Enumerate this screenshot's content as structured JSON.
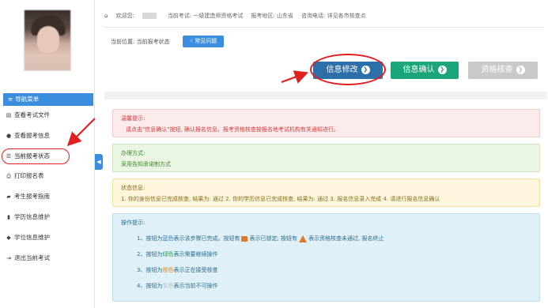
{
  "sidebar": {
    "nav_title": "导航菜单",
    "items": [
      {
        "label": "查看考试文件",
        "icon": "document-icon"
      },
      {
        "label": "查看报考信息",
        "icon": "info-icon"
      },
      {
        "label": "当前报考状态",
        "icon": "list-icon"
      },
      {
        "label": "打印报名表",
        "icon": "printer-icon"
      },
      {
        "label": "考生报考指南",
        "icon": "book-icon"
      },
      {
        "label": "学历信息维护",
        "icon": "file-icon"
      },
      {
        "label": "学位信息维护",
        "icon": "graduation-cap-icon"
      },
      {
        "label": "退出当前考试",
        "icon": "logout-icon"
      }
    ],
    "collapse_glyph": "◀"
  },
  "infobar": {
    "welcome": "欢迎您:",
    "exam": "当前考试: 一级建造师资格考试",
    "region": "报考地区: 山东省",
    "phone": "咨询电话: 详见各市核查点"
  },
  "breadcrumb": {
    "prefix": "当前位置:",
    "current": "当前报考状态",
    "faq_label": "常见问题"
  },
  "actions": {
    "modify": "信息修改",
    "confirm": "信息确认",
    "check": "资格核查"
  },
  "panels": {
    "warn": {
      "title": "温馨提示:",
      "body": "请点击\"信息确认\"按钮, 确认报名信息。报考资格核查按报名地考试机构有关通知进行。"
    },
    "method": {
      "title": "办理方式:",
      "body": "采用告知承诺制方式"
    },
    "status": {
      "title": "状态信息:",
      "body": "1. 你的身份信息已完成核查, 结果为: 通过 2. 你的学历信息已完成核查, 结果为: 通过 3. 报名信息录入完成 4. 请进行报名信息确认"
    },
    "ops": {
      "title": "操作提示:",
      "op1_a": "1、按钮为",
      "op1_blue": "蓝色",
      "op1_b": "表示该步骤已完成。按钮有",
      "op1_c": "表示已锁定; 按钮有",
      "op1_d": "表示资格核查未通过, 报名终止",
      "op2_a": "2、按钮为",
      "op2_green": "绿色",
      "op2_b": "表示需要继续操作",
      "op3_a": "3、按钮为",
      "op3_orange": "橙色",
      "op3_b": "表示正在接受核查",
      "op4_a": "4、按钮为",
      "op4_gray": "灰色",
      "op4_b": "表示当前不可操作"
    }
  },
  "colors": {
    "accent": "#3b8ede",
    "modify_button": "#2d6fa8",
    "confirm_button": "#1aa67a",
    "disabled_button": "#c9c9c9",
    "annotation_red": "#e02020"
  }
}
